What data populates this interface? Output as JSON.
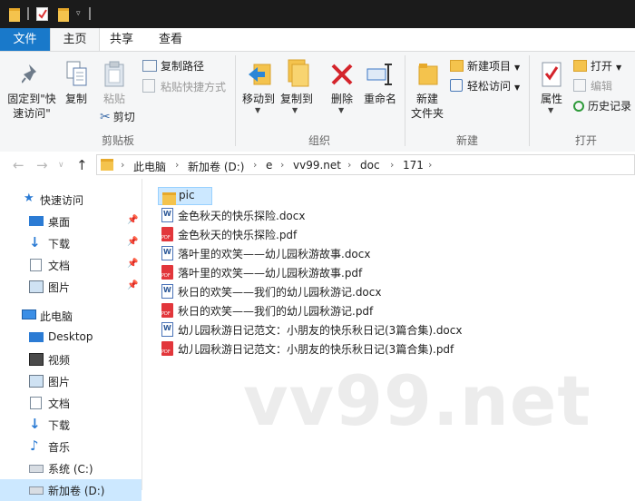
{
  "tabs": {
    "file": "文件",
    "home": "主页",
    "share": "共享",
    "view": "查看"
  },
  "ribbon": {
    "pin_label_1": "固定到\"快",
    "pin_label_2": "速访问\"",
    "copy": "复制",
    "paste": "粘贴",
    "copy_path": "复制路径",
    "paste_shortcut": "粘贴快捷方式",
    "cut": "剪切",
    "group_clipboard": "剪贴板",
    "move_to": "移动到",
    "copy_to": "复制到",
    "delete": "删除",
    "rename": "重命名",
    "group_organize": "组织",
    "new_folder_1": "新建",
    "new_folder_2": "文件夹",
    "new_item": "新建项目",
    "easy_access": "轻松访问",
    "group_new": "新建",
    "properties": "属性",
    "open": "打开",
    "edit": "编辑",
    "history": "历史记录",
    "group_open": "打开"
  },
  "address": {
    "crumbs": [
      "此电脑",
      "新加卷 (D:)",
      "e",
      "vv99.net",
      "doc",
      "171"
    ]
  },
  "nav": {
    "quick_access": "快速访问",
    "quick_items": [
      "桌面",
      "下载",
      "文档",
      "图片"
    ],
    "this_pc": "此电脑",
    "pc_items": [
      "Desktop",
      "视频",
      "图片",
      "文档",
      "下载",
      "音乐",
      "系统 (C:)",
      "新加卷 (D:)"
    ]
  },
  "files": [
    {
      "name": "pic",
      "type": "folder"
    },
    {
      "name": "金色秋天的快乐探险.docx",
      "type": "docx"
    },
    {
      "name": "金色秋天的快乐探险.pdf",
      "type": "pdf"
    },
    {
      "name": "落叶里的欢笑——幼儿园秋游故事.docx",
      "type": "docx"
    },
    {
      "name": "落叶里的欢笑——幼儿园秋游故事.pdf",
      "type": "pdf"
    },
    {
      "name": "秋日的欢笑——我们的幼儿园秋游记.docx",
      "type": "docx"
    },
    {
      "name": "秋日的欢笑——我们的幼儿园秋游记.pdf",
      "type": "pdf"
    },
    {
      "name": "幼儿园秋游日记范文：小朋友的快乐秋日记(3篇合集).docx",
      "type": "docx"
    },
    {
      "name": "幼儿园秋游日记范文：小朋友的快乐秋日记(3篇合集).pdf",
      "type": "pdf"
    }
  ],
  "watermark": "vv99.net",
  "colors": {
    "accent": "#1979ca",
    "selection": "#cce8ff",
    "folder": "#f4c34d",
    "pdf": "#e2363b",
    "word": "#2b5797"
  }
}
